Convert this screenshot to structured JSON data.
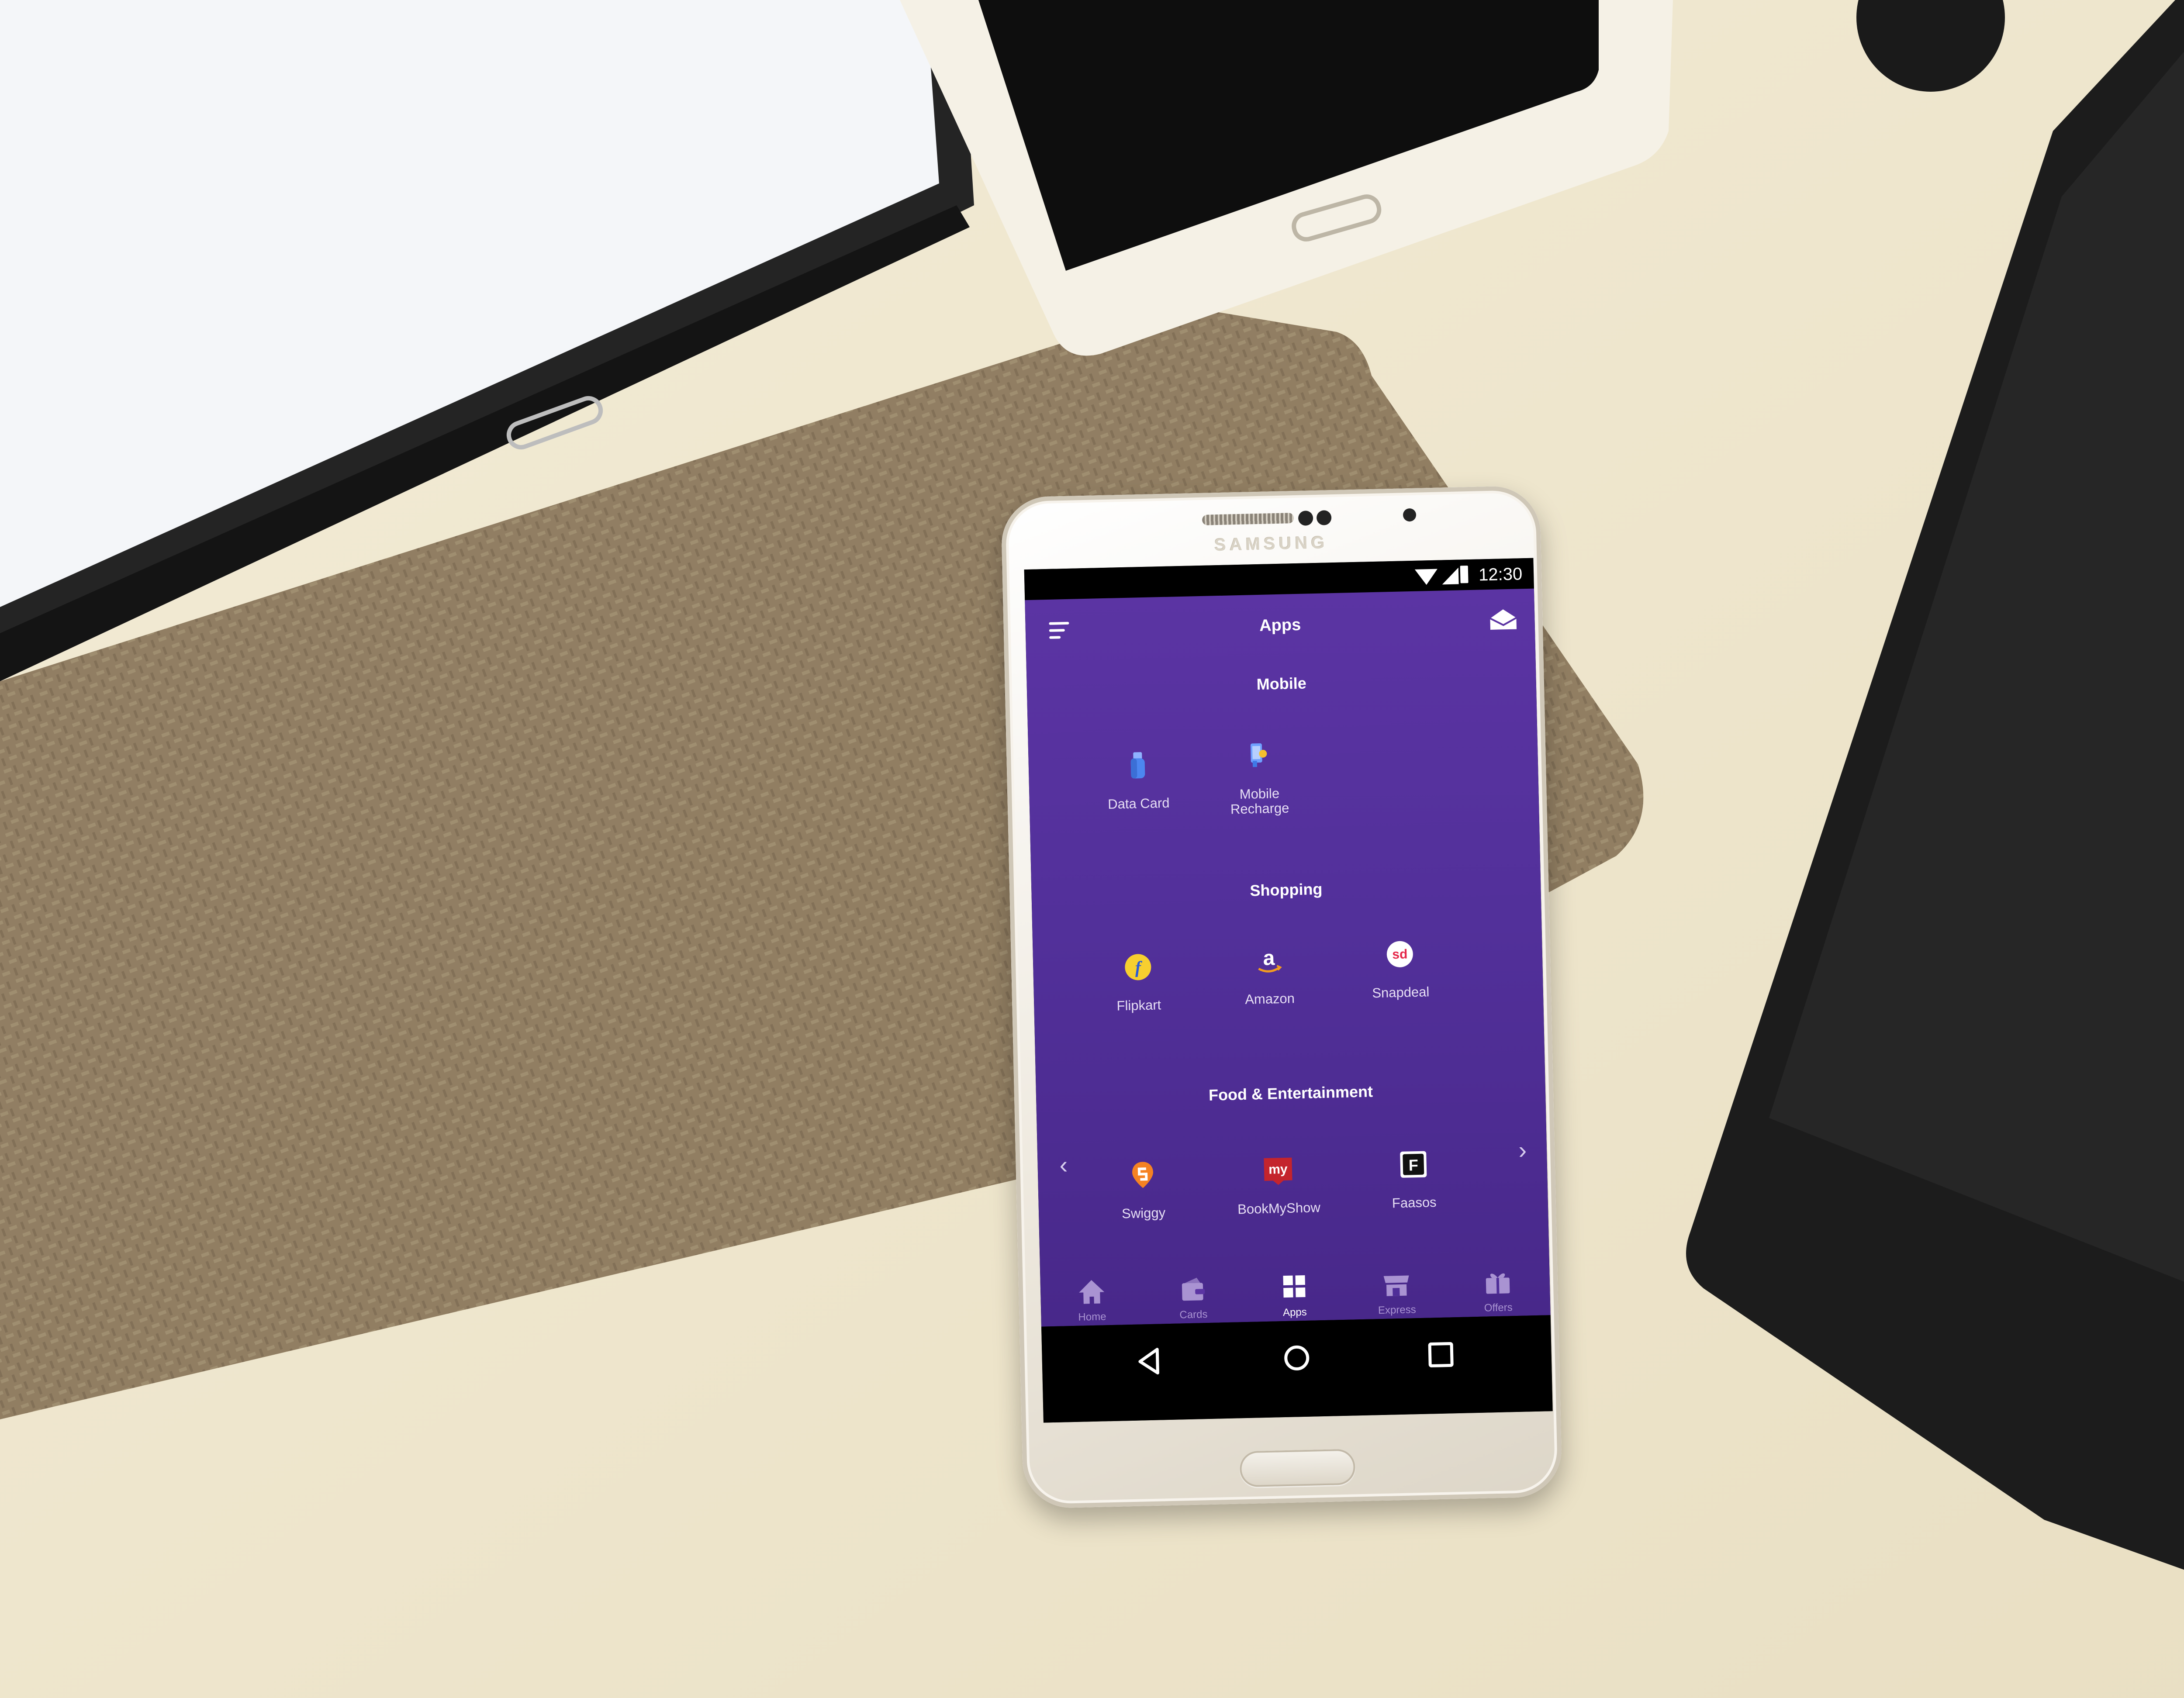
{
  "status_bar": {
    "time": "12:30"
  },
  "device": {
    "brand": "SAMSUNG"
  },
  "header": {
    "title": "Apps"
  },
  "sections": [
    {
      "title": "Mobile",
      "items": [
        {
          "label": "Data Card",
          "icon": "usb-stick-icon"
        },
        {
          "label": "Mobile\nRecharge",
          "icon": "mobile-recharge-icon"
        }
      ]
    },
    {
      "title": "Shopping",
      "items": [
        {
          "label": "Flipkart",
          "icon": "flipkart-logo-icon"
        },
        {
          "label": "Amazon",
          "icon": "amazon-logo-icon"
        },
        {
          "label": "Snapdeal",
          "icon": "snapdeal-logo-icon"
        }
      ]
    },
    {
      "title": "Food & Entertainment",
      "items": [
        {
          "label": "Swiggy",
          "icon": "swiggy-logo-icon"
        },
        {
          "label": "BookMyShow",
          "icon": "bookmyshow-logo-icon"
        },
        {
          "label": "Faasos",
          "icon": "faasos-logo-icon"
        }
      ]
    }
  ],
  "tabs": [
    {
      "label": "Home",
      "icon": "home-icon",
      "active": false
    },
    {
      "label": "Cards",
      "icon": "cards-icon",
      "active": false
    },
    {
      "label": "Apps",
      "icon": "apps-grid-icon",
      "active": true
    },
    {
      "label": "Express",
      "icon": "express-store-icon",
      "active": false
    },
    {
      "label": "Offers",
      "icon": "gift-icon",
      "active": false
    }
  ],
  "colors": {
    "app_background_top": "#5b34a3",
    "app_background_bottom": "#48288a",
    "inactive_tab": "#a993d2",
    "active_tab": "#ffffff"
  }
}
